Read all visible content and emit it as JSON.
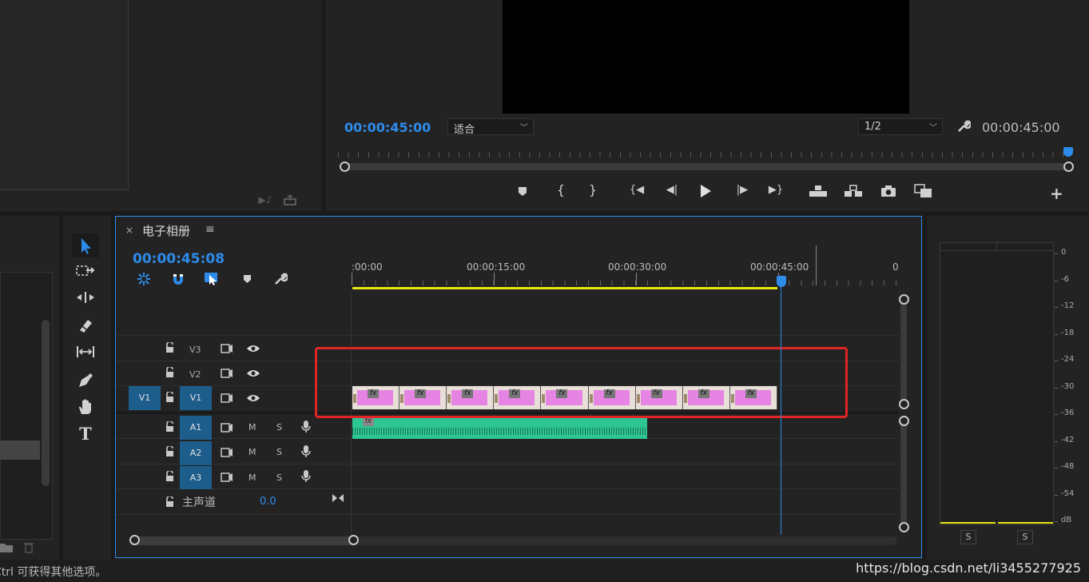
{
  "source_panel": {
    "icons": [
      "insert-audio-icon",
      "export-icon"
    ]
  },
  "program_monitor": {
    "timecode_current": "00:00:45:00",
    "fit_select": "适合",
    "resolution_select": "1/2",
    "timecode_duration": "00:00:45:00"
  },
  "timeline": {
    "close_glyph": "×",
    "sequence_name": "电子相册",
    "menu_glyph": "≡",
    "timecode": "00:00:45:08",
    "ruler_labels": [
      ":00:00",
      "00:00:15:00",
      "00:00:30:00",
      "00:00:45:00",
      "0"
    ],
    "video_tracks": [
      {
        "name": "V3",
        "source_patch": ""
      },
      {
        "name": "V2",
        "source_patch": ""
      },
      {
        "name": "V1",
        "source_patch": "V1"
      }
    ],
    "audio_tracks": [
      {
        "name": "A1",
        "m": "M",
        "s": "S"
      },
      {
        "name": "A2",
        "m": "M",
        "s": "S"
      },
      {
        "name": "A3",
        "m": "M",
        "s": "S"
      }
    ],
    "master": {
      "label": "主声道",
      "value": "0.0"
    },
    "clip_badge": "fx"
  },
  "audio_meter": {
    "scale": [
      "0",
      "-6",
      "-12",
      "-18",
      "-24",
      "-30",
      "-36",
      "-42",
      "-48",
      "-54",
      "dB"
    ],
    "solo_left": "S",
    "solo_right": "S"
  },
  "status_bar": {
    "hint": "Ctrl 可获得其他选项。",
    "watermark": "https://blog.csdn.net/li3455277925"
  },
  "colors": {
    "accent": "#2d8ceb",
    "clip_video": "#e584e2",
    "clip_audio": "#2ec594",
    "highlight_box": "#e02525",
    "work_area": "#e8e814"
  }
}
